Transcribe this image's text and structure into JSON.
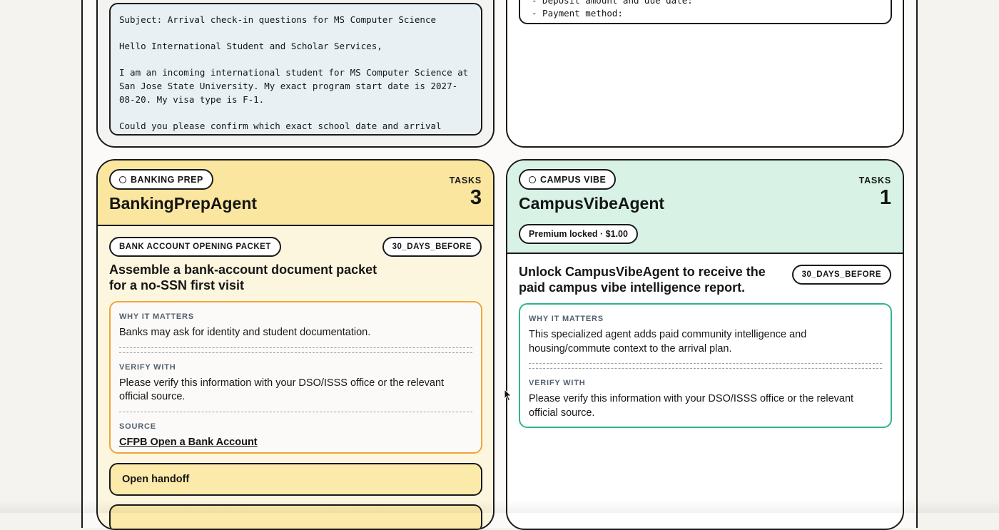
{
  "email_draft": {
    "subject_line": "Subject: Arrival check-in questions for MS Computer Science",
    "greeting": "Hello International Student and Scholar Services,",
    "body_paragraph": "I am an incoming international student for MS Computer Science at San Jose State University. My exact program start date is 2027-08-20. My visa type is F-1.",
    "question_paragraph": "Could you please confirm which exact school date and arrival check-in"
  },
  "checklist_preview": {
    "lines": [
      "- Deposit amount and due date:",
      "- Payment method:"
    ]
  },
  "banking_agent": {
    "badge": "BANKING PREP",
    "tasks_label": "TASKS",
    "tasks_count": "3",
    "name": "BankingPrepAgent",
    "task": {
      "category": "BANK ACCOUNT OPENING PACKET",
      "timing": "30_DAYS_BEFORE",
      "title": "Assemble a bank-account document packet for a no-SSN first visit",
      "why_label": "WHY IT MATTERS",
      "why_text": "Banks may ask for identity and student documentation.",
      "verify_label": "VERIFY WITH",
      "verify_text": "Please verify this information with your DSO/ISSS office or the relevant official source.",
      "source_label": "SOURCE",
      "source_link": "CFPB Open a Bank Account",
      "handoff_label": "Open handoff"
    }
  },
  "campus_agent": {
    "badge": "CAMPUS VIBE",
    "tasks_label": "TASKS",
    "tasks_count": "1",
    "name": "CampusVibeAgent",
    "premium": "Premium locked · $1.00",
    "task": {
      "timing": "30_DAYS_BEFORE",
      "title": "Unlock CampusVibeAgent to receive the paid campus vibe intelligence report.",
      "why_label": "WHY IT MATTERS",
      "why_text": "This specialized agent adds paid community intelligence and housing/commute context to the arrival plan.",
      "verify_label": "VERIFY WITH",
      "verify_text": "Please verify this information with your DSO/ISSS office or the relevant official source."
    }
  },
  "colors": {
    "banking_header": "#fbe6a0",
    "banking_body": "#fdf6de",
    "campus_header": "#d8f3e6",
    "banking_border": "#efa43a",
    "campus_border": "#2fb58b"
  }
}
